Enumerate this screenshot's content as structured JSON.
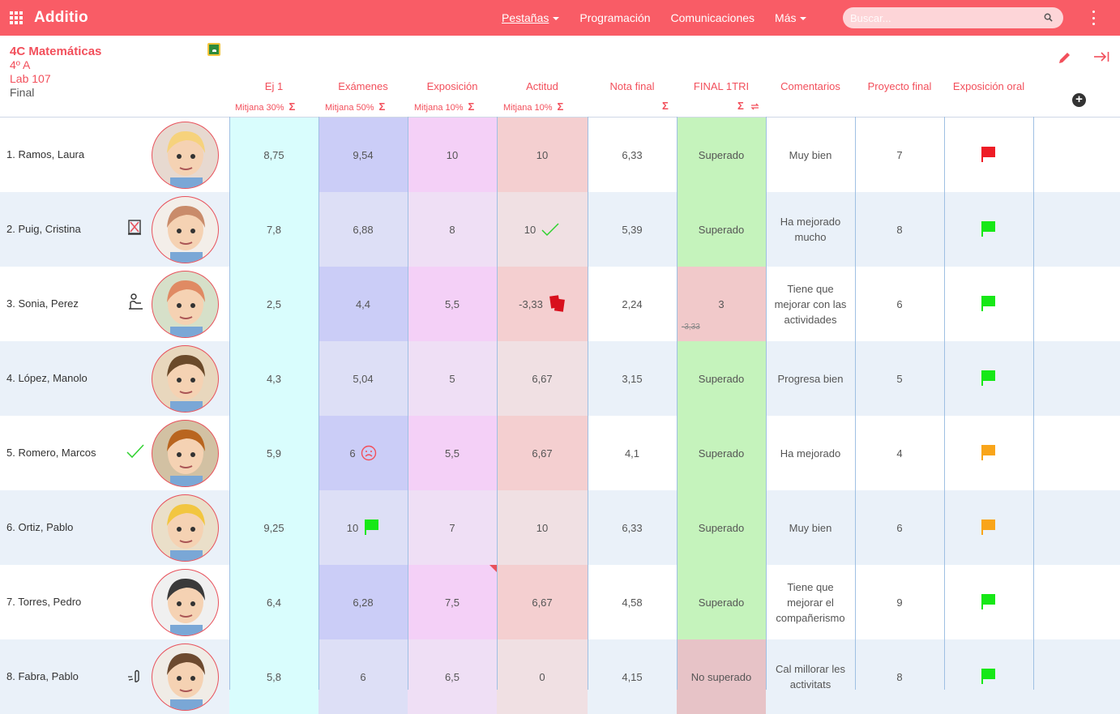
{
  "app": {
    "name": "Additio"
  },
  "nav": {
    "pestanas": "Pestañas",
    "programacion": "Programación",
    "comunicaciones": "Comunicaciones",
    "mas": "Más"
  },
  "search": {
    "placeholder": "Buscar..."
  },
  "class": {
    "title": "4C Matemáticas",
    "group": "4º A",
    "room": "Lab 107",
    "term": "Final"
  },
  "columns": [
    {
      "name": "Ej 1",
      "sub": "Mitjana 30%"
    },
    {
      "name": "Exámenes",
      "sub": "Mitjana 50%"
    },
    {
      "name": "Exposición",
      "sub": "Mitjana 10%"
    },
    {
      "name": "Actitud",
      "sub": "Mitjana 10%"
    },
    {
      "name": "Nota final",
      "sub": ""
    },
    {
      "name": "FINAL 1TRI",
      "sub": ""
    },
    {
      "name": "Comentarios",
      "sub": ""
    },
    {
      "name": "Proyecto final",
      "sub": ""
    },
    {
      "name": "Exposición oral",
      "sub": ""
    }
  ],
  "sigma": "Σ",
  "colors": {
    "accent": "#f95c66",
    "flag_red": "#ee1c25",
    "flag_green": "#17e817",
    "flag_orange": "#f9a51a"
  },
  "students": [
    {
      "name": "1. Ramos, Laura",
      "ej1": "8,75",
      "examenes": "9,54",
      "exposicion": "10",
      "actitud": "10",
      "nota_final": "6,33",
      "final1tri": "Superado",
      "comentarios": "Muy bien",
      "proyecto": "7",
      "flag": "red"
    },
    {
      "name": "2. Puig, Cristina",
      "ej1": "7,8",
      "examenes": "6,88",
      "exposicion": "8",
      "actitud": "10",
      "nota_final": "5,39",
      "final1tri": "Superado",
      "comentarios": "Ha mejorado mucho",
      "proyecto": "8",
      "flag": "green"
    },
    {
      "name": "3. Sonia, Perez",
      "ej1": "2,5",
      "examenes": "4,4",
      "exposicion": "5,5",
      "actitud": "-3,33",
      "nota_final": "2,24",
      "final1tri": "3",
      "final1tri_old": "-3,33",
      "comentarios": "Tiene que mejorar con las actividades",
      "proyecto": "6",
      "flag": "green"
    },
    {
      "name": "4. López, Manolo",
      "ej1": "4,3",
      "examenes": "5,04",
      "exposicion": "5",
      "actitud": "6,67",
      "nota_final": "3,15",
      "final1tri": "Superado",
      "comentarios": "Progresa bien",
      "proyecto": "5",
      "flag": "green"
    },
    {
      "name": "5. Romero, Marcos",
      "ej1": "5,9",
      "examenes": "6",
      "exposicion": "5,5",
      "actitud": "6,67",
      "nota_final": "4,1",
      "final1tri": "Superado",
      "comentarios": "Ha mejorado",
      "proyecto": "4",
      "flag": "orange"
    },
    {
      "name": "6. Ortiz, Pablo",
      "ej1": "9,25",
      "examenes": "10",
      "exposicion": "7",
      "actitud": "10",
      "nota_final": "6,33",
      "final1tri": "Superado",
      "comentarios": "Muy bien",
      "proyecto": "6",
      "flag": "orange"
    },
    {
      "name": "7. Torres, Pedro",
      "ej1": "6,4",
      "examenes": "6,28",
      "exposicion": "7,5",
      "actitud": "6,67",
      "nota_final": "4,58",
      "final1tri": "Superado",
      "comentarios": "Tiene que mejorar el compañerismo",
      "proyecto": "9",
      "flag": "green"
    },
    {
      "name": "8. Fabra, Pablo",
      "ej1": "5,8",
      "examenes": "6",
      "exposicion": "6,5",
      "actitud": "0",
      "nota_final": "4,15",
      "final1tri": "No superado",
      "comentarios": "Cal millorar les activitats",
      "proyecto": "8",
      "flag": "green"
    }
  ]
}
